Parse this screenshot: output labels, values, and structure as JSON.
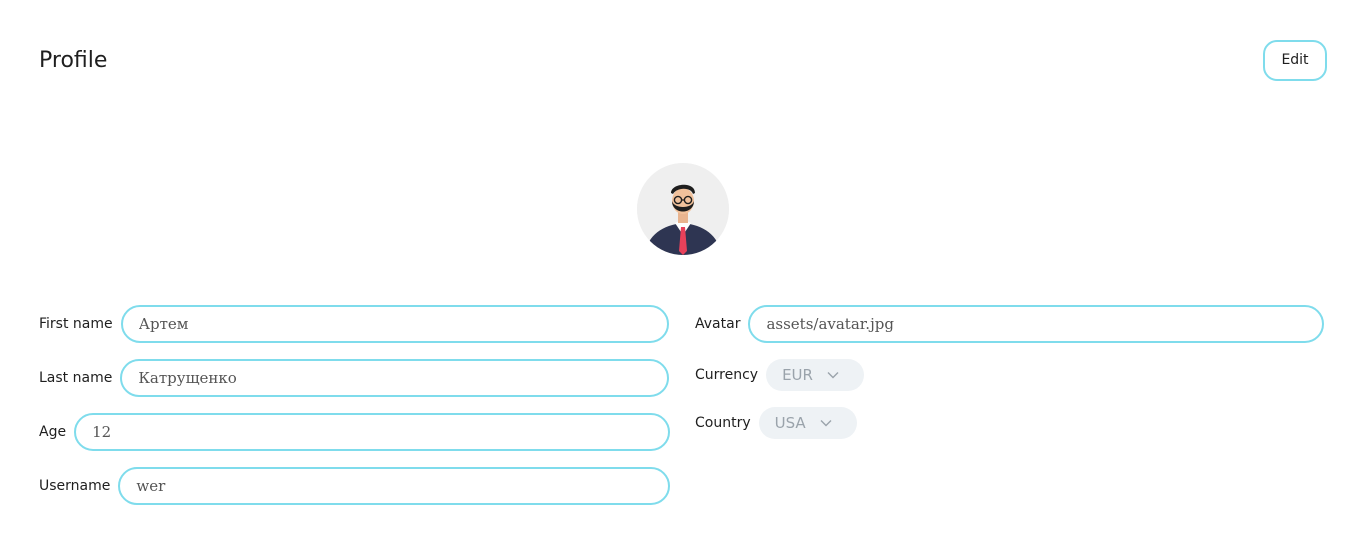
{
  "header": {
    "title": "Profile",
    "edit_label": "Edit"
  },
  "avatar": {
    "icon": "user-avatar-illustration"
  },
  "form": {
    "first_name": {
      "label": "First name",
      "value": "Артем"
    },
    "last_name": {
      "label": "Last name",
      "value": "Катрущенко"
    },
    "age": {
      "label": "Age",
      "value": "12"
    },
    "username": {
      "label": "Username",
      "value": "wer"
    },
    "avatar": {
      "label": "Avatar",
      "value": "assets/avatar.jpg"
    },
    "currency": {
      "label": "Currency",
      "value": "EUR"
    },
    "country": {
      "label": "Country",
      "value": "USA"
    }
  },
  "colors": {
    "accent_border": "#7fdcec",
    "select_bg": "#eef2f5",
    "tie": "#e8415a",
    "suit": "#2e3552"
  }
}
